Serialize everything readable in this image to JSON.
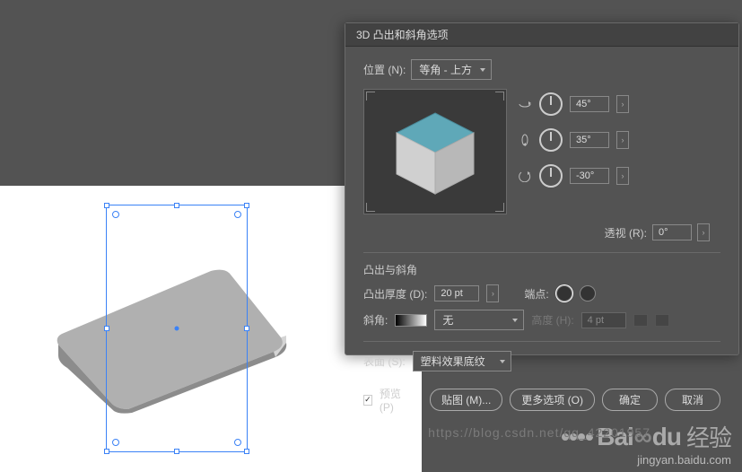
{
  "dialog": {
    "title": "3D 凸出和斜角选项",
    "position_label": "位置 (N):",
    "position_value": "等角 - 上方",
    "angles": {
      "x": "45°",
      "y": "35°",
      "z": "-30°"
    },
    "perspective_label": "透视 (R):",
    "perspective_value": "0°",
    "extrude_section": "凸出与斜角",
    "extrude_depth_label": "凸出厚度 (D):",
    "extrude_depth_value": "20 pt",
    "cap_label": "端点:",
    "bevel_label": "斜角:",
    "bevel_value": "无",
    "bevel_height_label": "高度 (H):",
    "bevel_height_value": "4 pt",
    "surface_label": "表面 (S):",
    "surface_value": "塑料效果底纹",
    "preview_label": "预览 (P)",
    "map_button": "贴图 (M)...",
    "more_button": "更多选项 (O)",
    "ok_button": "确定",
    "cancel_button": "取消"
  },
  "watermark": {
    "brand": "Bai",
    "brand2": "du",
    "suffix": "经验",
    "url_behind": "https://blog.csdn.net/qq_42201957",
    "sub": "jingyan.baidu.com"
  }
}
